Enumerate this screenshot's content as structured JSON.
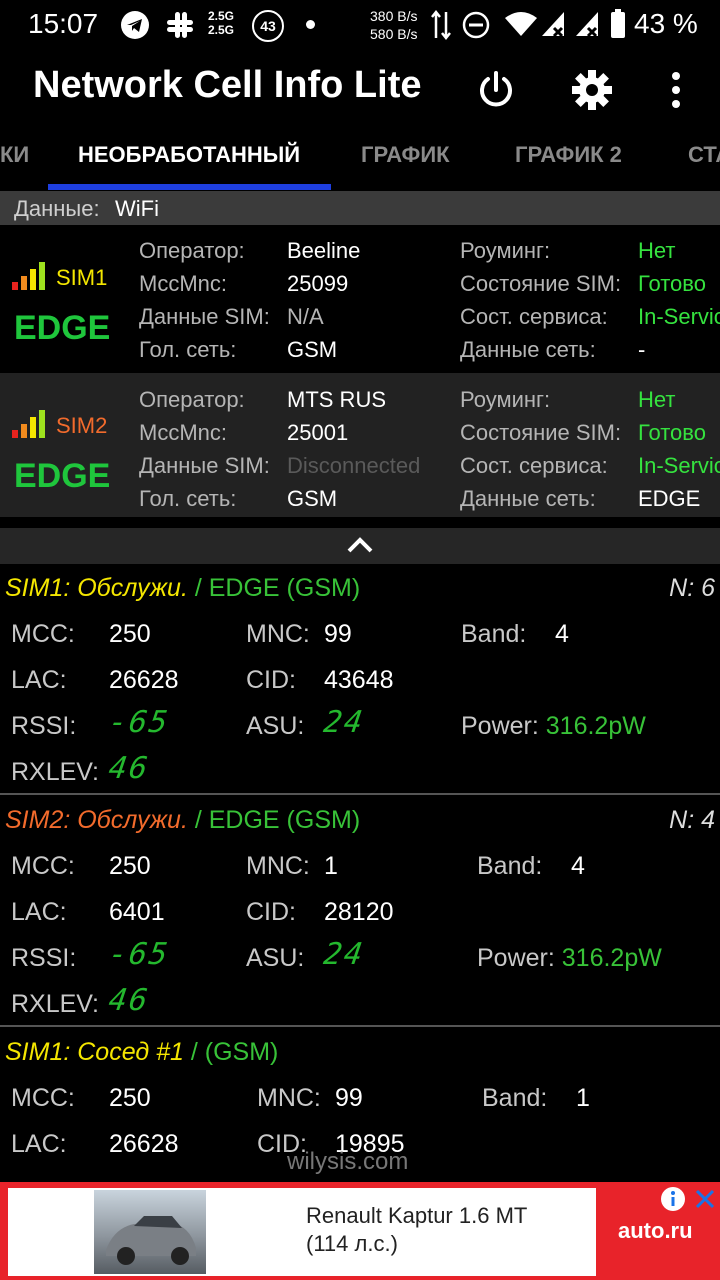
{
  "status_bar": {
    "time": "15:07",
    "net_top": "2.5G",
    "net_bottom": "2.5G",
    "notif_count": "43",
    "speed_up": "380 B/s",
    "speed_down": "580 B/s",
    "battery": "43 %",
    "icons": [
      "telegram-icon",
      "slack-icon",
      "dot-icon",
      "arrows-icon",
      "dnd-icon",
      "wifi-icon",
      "signal-icon",
      "signal-icon",
      "battery-icon"
    ]
  },
  "app": {
    "title": "Network Cell Info Lite",
    "power_icon": "power-icon",
    "settings_icon": "gear-icon",
    "menu_icon": "more-vert-icon"
  },
  "tabs": [
    "КИ",
    "НЕОБРАБОТАННЫЙ",
    "ГРАФИК",
    "ГРАФИК 2",
    "СТА"
  ],
  "active_tab": "НЕОБРАБОТАННЫЙ",
  "data_bar": {
    "label": "Данные:",
    "value": "WiFi"
  },
  "sims": [
    {
      "name": "SIM1",
      "tech": "EDGE",
      "operator_label": "Оператор:",
      "operator": "Beeline",
      "mccmnc_label": "MccMnc:",
      "mccmnc": "25099",
      "data_sim_label": "Данные SIM:",
      "data_sim": "N/A",
      "voice_label": "Гол. сеть:",
      "voice": "GSM",
      "roaming_label": "Роуминг:",
      "roaming": "Нет",
      "sim_state_label": "Состояние SIM:",
      "sim_state": "Готово",
      "service_label": "Сост. сервиса:",
      "service": "In-Service",
      "data_net_label": "Данные сеть:",
      "data_net": "-"
    },
    {
      "name": "SIM2",
      "tech": "EDGE",
      "operator_label": "Оператор:",
      "operator": "MTS RUS",
      "mccmnc_label": "MccMnc:",
      "mccmnc": "25001",
      "data_sim_label": "Данные SIM:",
      "data_sim": "Disconnected",
      "voice_label": "Гол. сеть:",
      "voice": "GSM",
      "roaming_label": "Роуминг:",
      "roaming": "Нет",
      "sim_state_label": "Состояние SIM:",
      "sim_state": "Готово",
      "service_label": "Сост. сервиса:",
      "service": "In-Service",
      "data_net_label": "Данные сеть:",
      "data_net": "EDGE"
    }
  ],
  "cells": [
    {
      "title": "SIM1: Обслужи.",
      "subtitle": "/ EDGE (GSM)",
      "n": "N: 6",
      "mcc_label": "MCC:",
      "mcc": "250",
      "mnc_label": "MNC:",
      "mnc": "99",
      "band_label": "Band:",
      "band": "4",
      "lac_label": "LAC:",
      "lac": "26628",
      "cid_label": "CID:",
      "cid": "43648",
      "rssi_label": "RSSI:",
      "rssi": "-65",
      "asu_label": "ASU:",
      "asu": "24",
      "power_label": "Power:",
      "power": "316.2pW",
      "rxlev_label": "RXLEV:",
      "rxlev": "46"
    },
    {
      "title": "SIM2: Обслужи.",
      "subtitle": "/ EDGE (GSM)",
      "n": "N: 4",
      "mcc_label": "MCC:",
      "mcc": "250",
      "mnc_label": "MNC:",
      "mnc": "1",
      "band_label": "Band:",
      "band": "4",
      "lac_label": "LAC:",
      "lac": "6401",
      "cid_label": "CID:",
      "cid": "28120",
      "rssi_label": "RSSI:",
      "rssi": "-65",
      "asu_label": "ASU:",
      "asu": "24",
      "power_label": "Power:",
      "power": "316.2pW",
      "rxlev_label": "RXLEV:",
      "rxlev": "46"
    },
    {
      "title": "SIM1: Сосед #1",
      "subtitle": "/ (GSM)",
      "mcc_label": "MCC:",
      "mcc": "250",
      "mnc_label": "MNC:",
      "mnc": "99",
      "band_label": "Band:",
      "band": "1",
      "lac_label": "LAC:",
      "lac": "26628",
      "cid_label": "CID:",
      "cid": "19895"
    }
  ],
  "watermark": "wilysis.com",
  "ad": {
    "line1": "Renault Kaptur 1.6 MT",
    "line2": "(114 л.с.)",
    "brand": "auto.ru"
  },
  "colors": {
    "accent_tab": "#1e3fe0",
    "ok_green": "#35e23f",
    "sim1_yellow": "#f4e600",
    "sim2_orange": "#f26b2c",
    "ad_red": "#e8232a"
  }
}
